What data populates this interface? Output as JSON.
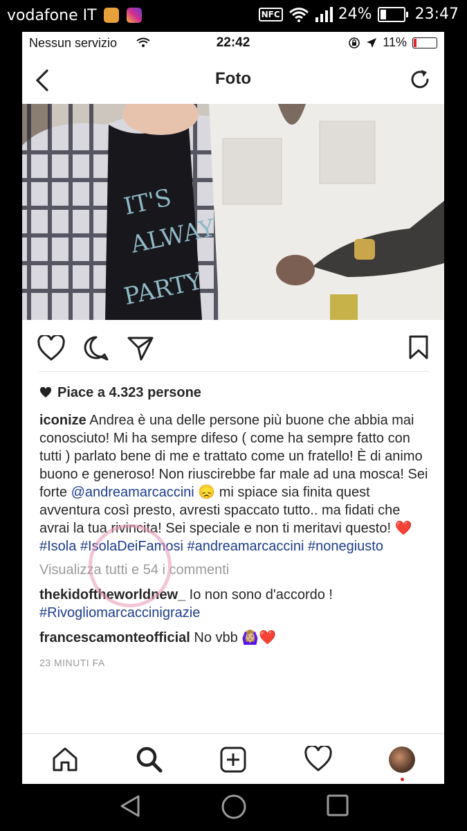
{
  "outer_status": {
    "carrier": "vodafone IT",
    "nfc": "NFC",
    "battery": "24%",
    "battery_level": 0.24,
    "time": "23:47"
  },
  "inner_status": {
    "carrier": "Nessun servizio",
    "time": "22:42",
    "battery": "11%",
    "battery_level": 0.11
  },
  "nav": {
    "title": "Foto"
  },
  "post": {
    "likes": "Piace a 4.323 persone",
    "caption_user": "iconize",
    "caption_text_1": " Andrea è una delle persone più buone che abbia mai conosciuto! Mi ha sempre difeso ( come ha sempre fatto con tutti ) parlato bene di me e trattato come un fratello! È di animo buono e generoso! Non riuscirebbe far male ad una mosca! Sei forte ",
    "mention": "@andreamarcaccini",
    "caption_emoji": "😞",
    "caption_text_2": " mi spiace sia finita quest avventura così presto, avresti spaccato tutto.. ma fidati che avrai la tua rivincita! Sei speciale e non ti meritavi questo! ",
    "caption_heart": "❤️",
    "hashtags": [
      "#Isola",
      "#IsolaDeiFamosi",
      "#andreamarcaccini",
      "#nonegiusto"
    ],
    "view_all": "Visualizza tutti e 54 i commenti",
    "comments": [
      {
        "user": "thekidoftheworldnew_",
        "text": " Io non sono d'accordo ! ",
        "tag": "#Rivogliomarcaccinigrazie"
      },
      {
        "user": "francescamonteofficial",
        "text": " No vbb 🙆🏼‍♀️❤️"
      }
    ],
    "time_ago": "23 MINUTI FA"
  }
}
